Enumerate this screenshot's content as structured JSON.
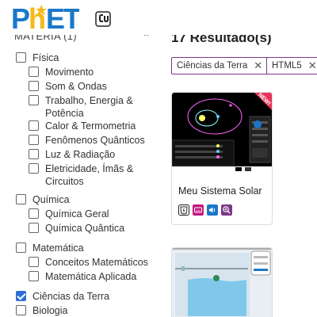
{
  "header": {
    "logo_text": "PhET"
  },
  "sidebar": {
    "section_title": "MATÉRIA (1)",
    "items": [
      {
        "label": "Física",
        "checked": false
      },
      {
        "label": "Movimento",
        "checked": false
      },
      {
        "label": "Som & Ondas",
        "checked": false
      },
      {
        "label": "Trabalho, Energia &",
        "label2": "Potência",
        "checked": false
      },
      {
        "label": "Calor & Termometria",
        "checked": false
      },
      {
        "label": "Fenômenos Quânticos",
        "checked": false
      },
      {
        "label": "Luz & Radiação",
        "checked": false
      },
      {
        "label": "Eletricidade, Ímãs &",
        "label2": "Circuitos",
        "checked": false
      },
      {
        "label": "Química",
        "checked": false
      },
      {
        "label": "Química Geral",
        "checked": false
      },
      {
        "label": "Química Quântica",
        "checked": false
      },
      {
        "label": "Matemática",
        "checked": false
      },
      {
        "label": "Conceitos Matemáticos",
        "checked": false
      },
      {
        "label": "Matemática Aplicada",
        "checked": false
      },
      {
        "label": "Ciências da Terra",
        "checked": true
      },
      {
        "label": "Biologia",
        "checked": false
      }
    ]
  },
  "main": {
    "results_title": "17 Resultado(s)",
    "filters": [
      {
        "label": "Ciências da Terra"
      },
      {
        "label": "HTML5"
      }
    ],
    "cards": [
      {
        "title": "Meu Sistema Solar",
        "ribbon": "NEW!"
      }
    ]
  },
  "colors": {
    "brand_yellow": "#f5b918",
    "brand_blue": "#1a78c8",
    "chip_border": "#7b3a8a",
    "check_blue": "#2c6fd6"
  }
}
